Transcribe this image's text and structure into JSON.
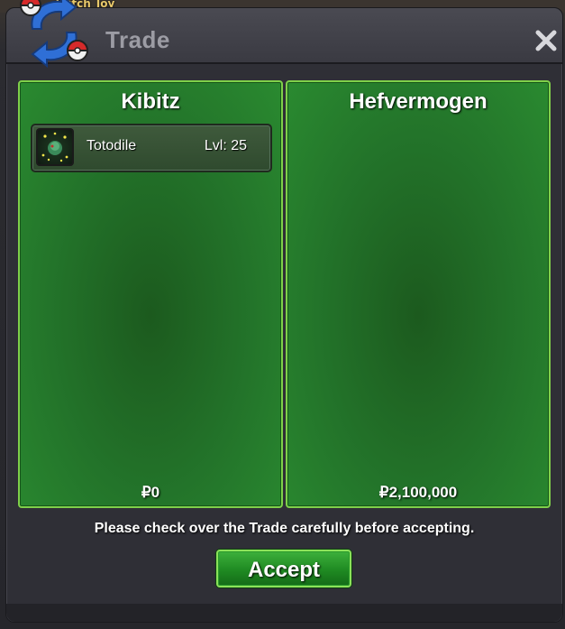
{
  "background": {
    "partial_label": "Witch_Joy"
  },
  "window": {
    "title": "Trade",
    "close_icon": "close-icon",
    "logo_icon": "trade-swap-icon"
  },
  "left_trader": {
    "name": "Kibitz",
    "money": "₽0",
    "items": [
      {
        "name": "Totodile",
        "level": "Lvl: 25",
        "icon": "pokemon-sprite-icon"
      }
    ]
  },
  "right_trader": {
    "name": "Hefvermogen",
    "money": "₽2,100,000",
    "items": []
  },
  "notice": "Please check over the Trade carefully before accepting.",
  "accept_button": {
    "label": "Accept"
  },
  "colors": {
    "panel_green": "#23742a",
    "panel_border": "#7fd04a",
    "accept_green": "#1f8a22",
    "window_bg": "#2f2f36"
  }
}
